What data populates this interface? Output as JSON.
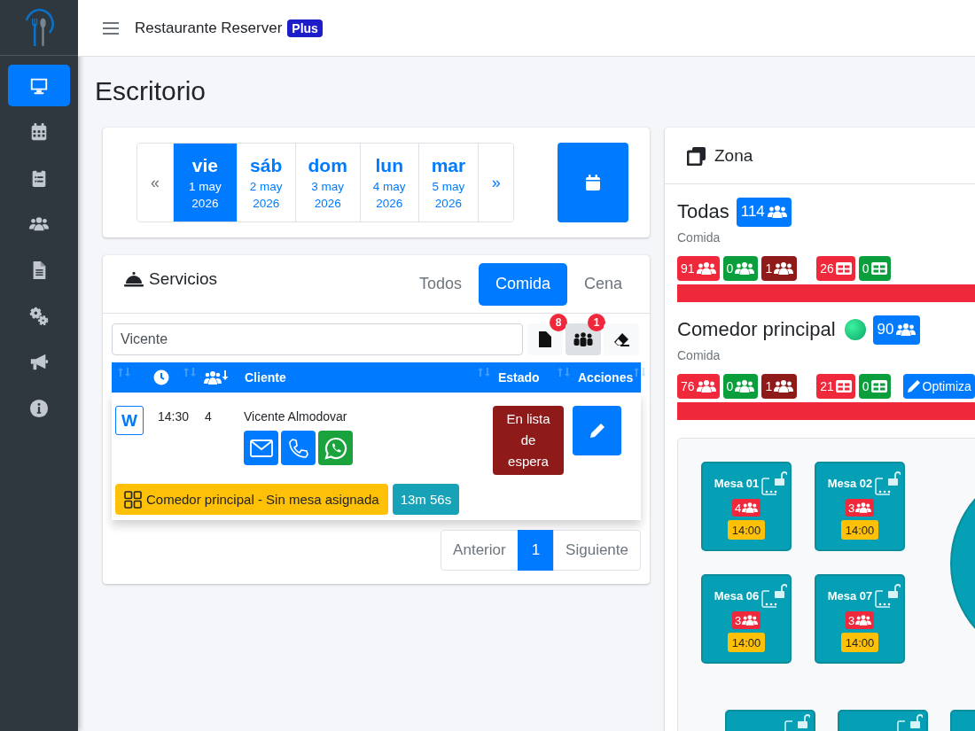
{
  "app": {
    "title": "Restaurante Reserver",
    "badge": "Plus"
  },
  "sidebar": {
    "items": [
      {
        "kind": "desktop",
        "selected": true
      },
      {
        "kind": "calendar",
        "selected": false
      },
      {
        "kind": "clipboard",
        "selected": false
      },
      {
        "kind": "users",
        "selected": false
      },
      {
        "kind": "file",
        "selected": false
      },
      {
        "kind": "gears",
        "selected": false
      },
      {
        "kind": "bullhorn",
        "selected": false
      },
      {
        "kind": "info",
        "selected": false
      }
    ]
  },
  "page_title": "Escritorio",
  "date_picker": {
    "prev": "«",
    "next": "»",
    "days": [
      {
        "weekday": "vie",
        "date": "1 may",
        "year": "2026",
        "selected": true
      },
      {
        "weekday": "sáb",
        "date": "2 may",
        "year": "2026",
        "selected": false
      },
      {
        "weekday": "dom",
        "date": "3 may",
        "year": "2026",
        "selected": false
      },
      {
        "weekday": "lun",
        "date": "4 may",
        "year": "2026",
        "selected": false
      },
      {
        "weekday": "mar",
        "date": "5 may",
        "year": "2026",
        "selected": false
      }
    ]
  },
  "services": {
    "title": "Servicios",
    "tabs": [
      {
        "label": "Todos",
        "selected": false
      },
      {
        "label": "Comida",
        "selected": true
      },
      {
        "label": "Cena",
        "selected": false
      }
    ],
    "search": {
      "value": "Vicente"
    },
    "tool_buttons": [
      {
        "kind": "document",
        "badge": "8",
        "selected": false
      },
      {
        "kind": "group",
        "badge": "1",
        "selected": true
      },
      {
        "kind": "eraser",
        "selected": false
      }
    ],
    "table": {
      "columns": [
        {
          "kind": "blank",
          "sorted": false
        },
        {
          "kind": "clock",
          "sorted": false
        },
        {
          "kind": "people",
          "sorted": true
        },
        {
          "kind": "text",
          "label": "Cliente",
          "sorted": false
        },
        {
          "kind": "text",
          "label": "Estado",
          "sorted": false
        },
        {
          "kind": "text",
          "label": "Acciones",
          "sorted": false
        }
      ],
      "rows": [
        {
          "source": "W",
          "time": "14:30",
          "guests": "4",
          "client": "Vicente Almodovar",
          "contacts": [
            {
              "kind": "email"
            },
            {
              "kind": "phone"
            },
            {
              "kind": "whatsapp"
            }
          ],
          "status": {
            "label": "En lista de espera",
            "kind": "waitlist"
          },
          "zone": "Comedor principal - Sin mesa asignada",
          "wait": "13m 56s"
        }
      ]
    },
    "pagination": {
      "prev": "Anterior",
      "pages": [
        {
          "label": "1",
          "selected": true
        }
      ],
      "next": "Siguiente"
    }
  },
  "zone": {
    "title": "Zona",
    "areas": [
      {
        "name": "Todas",
        "status_dot": false,
        "total": "114",
        "service": "Comida",
        "level": 1,
        "counts": [
          {
            "value": "91",
            "kind": "people",
            "color": "#f0283c"
          },
          {
            "value": "0",
            "kind": "people",
            "color": "#0a9e3c"
          },
          {
            "value": "1",
            "kind": "people",
            "color": "#8e1a1a"
          },
          {
            "value": "26",
            "kind": "tables",
            "color": "#f0283c"
          },
          {
            "value": "0",
            "kind": "tables",
            "color": "#0a9e3c"
          }
        ]
      },
      {
        "name": "Comedor principal",
        "status_dot": true,
        "total": "90",
        "service": "Comida",
        "level": 1,
        "optimize": "Optimiza",
        "counts": [
          {
            "value": "76",
            "kind": "people",
            "color": "#f0283c"
          },
          {
            "value": "0",
            "kind": "people",
            "color": "#0a9e3c"
          },
          {
            "value": "1",
            "kind": "people",
            "color": "#8e1a1a"
          },
          {
            "value": "21",
            "kind": "tables",
            "color": "#f0283c"
          },
          {
            "value": "0",
            "kind": "tables",
            "color": "#0a9e3c"
          }
        ]
      }
    ],
    "floor": [
      {
        "kind": "square",
        "name": "Mesa 01",
        "guests": "4",
        "time": "14:00"
      },
      {
        "kind": "square",
        "name": "Mesa 02",
        "guests": "3",
        "time": "14:00"
      },
      {
        "kind": "square",
        "name": "Mesa 06",
        "guests": "3",
        "time": "14:00"
      },
      {
        "kind": "square",
        "name": "Mesa 07",
        "guests": "3",
        "time": "14:00"
      },
      {
        "kind": "partial"
      },
      {
        "kind": "partial"
      },
      {
        "kind": "edge"
      },
      {
        "kind": "round"
      }
    ]
  }
}
